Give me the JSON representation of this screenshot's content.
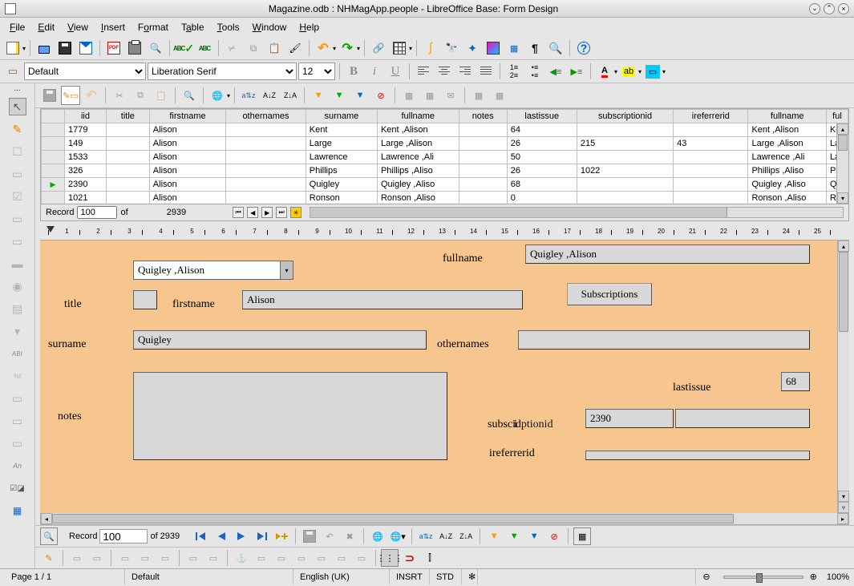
{
  "window": {
    "title": "Magazine.odb : NHMagApp.people - LibreOffice Base: Form Design"
  },
  "menus": [
    "File",
    "Edit",
    "View",
    "Insert",
    "Format",
    "Table",
    "Tools",
    "Window",
    "Help"
  ],
  "format_toolbar": {
    "style": "Default",
    "font": "Liberation Serif",
    "size": "12"
  },
  "grid": {
    "columns": [
      "iid",
      "title",
      "firstname",
      "othernames",
      "surname",
      "fullname",
      "notes",
      "lastissue",
      "subscriptionid",
      "ireferrerid",
      "fullname",
      "ful"
    ],
    "rows": [
      {
        "iid": "1779",
        "title": "",
        "firstname": "Alison",
        "othernames": "",
        "surname": "Kent",
        "fullname": "Kent ,Alison",
        "notes": "",
        "lastissue": "64",
        "subscriptionid": "",
        "ireferrerid": "",
        "fullname2": "Kent ,Alison",
        "ful": "Ke"
      },
      {
        "iid": "149",
        "title": "",
        "firstname": "Alison",
        "othernames": "",
        "surname": "Large",
        "fullname": "Large ,Alison",
        "notes": "",
        "lastissue": "26",
        "subscriptionid": "215",
        "ireferrerid": "43",
        "fullname2": "Large ,Alison",
        "ful": "La"
      },
      {
        "iid": "1533",
        "title": "",
        "firstname": "Alison",
        "othernames": "",
        "surname": "Lawrence",
        "fullname": "Lawrence ,Ali",
        "notes": "",
        "lastissue": "50",
        "subscriptionid": "",
        "ireferrerid": "",
        "fullname2": "Lawrence ,Ali",
        "ful": "La"
      },
      {
        "iid": "326",
        "title": "",
        "firstname": "Alison",
        "othernames": "",
        "surname": "Phillips",
        "fullname": "Phillips ,Aliso",
        "notes": "",
        "lastissue": "26",
        "subscriptionid": "1022",
        "ireferrerid": "",
        "fullname2": "Phillips ,Aliso",
        "ful": "Ph"
      },
      {
        "iid": "2390",
        "title": "",
        "firstname": "Alison",
        "othernames": "",
        "surname": "Quigley",
        "fullname": "Quigley ,Aliso",
        "notes": "",
        "lastissue": "68",
        "subscriptionid": "",
        "ireferrerid": "",
        "fullname2": "Quigley ,Aliso",
        "ful": "Qu"
      },
      {
        "iid": "1021",
        "title": "",
        "firstname": "Alison",
        "othernames": "",
        "surname": "Ronson",
        "fullname": "Ronson ,Aliso",
        "notes": "",
        "lastissue": "0",
        "subscriptionid": "",
        "ireferrerid": "",
        "fullname2": "Ronson ,Aliso",
        "ful": "Ro"
      }
    ]
  },
  "nav1": {
    "label": "Record",
    "current": "100",
    "of": "of",
    "total": "2939"
  },
  "ruler": [
    "1",
    "2",
    "3",
    "4",
    "5",
    "6",
    "7",
    "8",
    "9",
    "10",
    "11",
    "12",
    "13",
    "14",
    "15",
    "16",
    "17",
    "18",
    "19",
    "20",
    "21",
    "22",
    "23",
    "24",
    "25"
  ],
  "form": {
    "combo_value": "Quigley ,Alison",
    "fullname_label": "fullname",
    "fullname_value": "Quigley ,Alison",
    "subscriptions_button": "Subscriptions",
    "title_label": "title",
    "firstname_label": "firstname",
    "firstname_value": "Alison",
    "surname_label": "surname",
    "surname_value": "Quigley",
    "othernames_label": "othernames",
    "notes_label": "notes",
    "lastissue_label": "lastissue",
    "lastissue_value": "68",
    "subscriptionid_label": "subscriptionid",
    "subscriptionid_value": "2390",
    "ireferrerid_label": "ireferrerid"
  },
  "nav2": {
    "label": "Record",
    "current": "100",
    "of": "of",
    "total": "2939"
  },
  "statusbar": {
    "page": "Page 1 / 1",
    "style": "Default",
    "lang": "English (UK)",
    "insert": "INSRT",
    "sel": "STD",
    "zoom": "100%"
  }
}
